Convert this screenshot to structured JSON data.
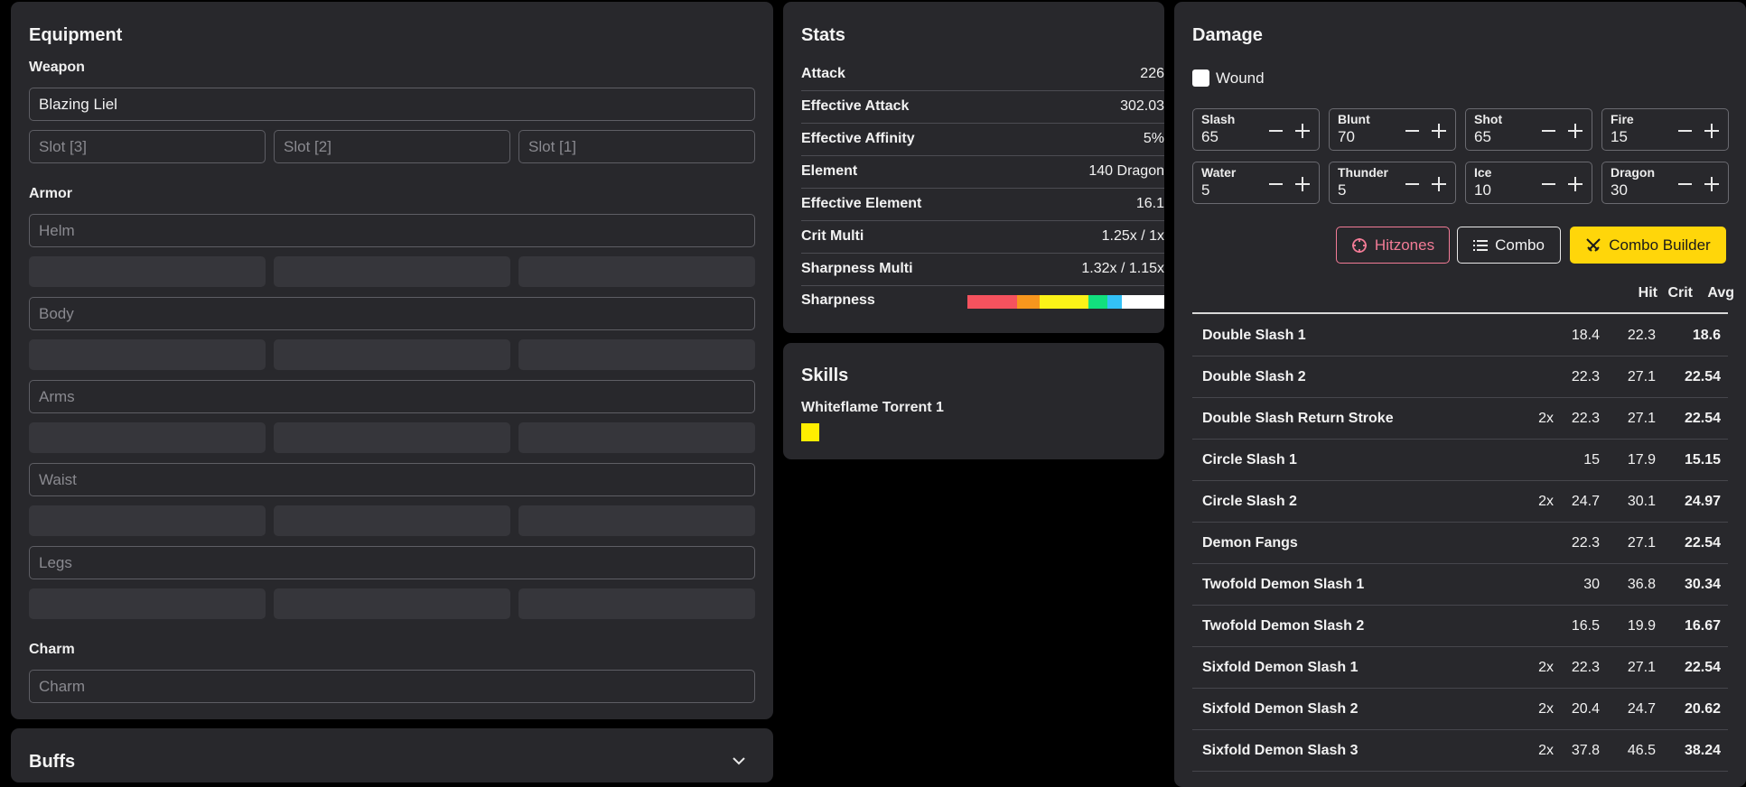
{
  "equipment": {
    "title": "Equipment",
    "weapon_label": "Weapon",
    "weapon_value": "Blazing Liel",
    "slots": [
      "Slot [3]",
      "Slot [2]",
      "Slot [1]"
    ],
    "armor_label": "Armor",
    "armor_pieces": [
      "Helm",
      "Body",
      "Arms",
      "Waist",
      "Legs"
    ],
    "charm_label": "Charm",
    "charm_placeholder": "Charm"
  },
  "buffs": {
    "title": "Buffs"
  },
  "stats": {
    "title": "Stats",
    "rows": [
      {
        "label": "Attack",
        "value": "226"
      },
      {
        "label": "Effective Attack",
        "value": "302.03"
      },
      {
        "label": "Effective Affinity",
        "value": "5%"
      },
      {
        "label": "Element",
        "value": "140 Dragon"
      },
      {
        "label": "Effective Element",
        "value": "16.1"
      },
      {
        "label": "Crit Multi",
        "value": "1.25x / 1x"
      },
      {
        "label": "Sharpness Multi",
        "value": "1.32x / 1.15x"
      }
    ],
    "sharpness_label": "Sharpness",
    "sharpness_segments": [
      {
        "color": "#f5525e",
        "fraction": 0.25
      },
      {
        "color": "#f7961d",
        "fraction": 0.115
      },
      {
        "color": "#fbf218",
        "fraction": 0.25
      },
      {
        "color": "#12e07e",
        "fraction": 0.095
      },
      {
        "color": "#33c1f7",
        "fraction": 0.075
      },
      {
        "color": "#ffffff",
        "fraction": 0.215
      }
    ]
  },
  "skills": {
    "title": "Skills",
    "items": [
      {
        "name": "Whiteflame Torrent 1",
        "level_color": "#ffee00"
      }
    ]
  },
  "damage": {
    "title": "Damage",
    "wound_label": "Wound",
    "wound_checked": false,
    "hitzones": [
      {
        "label": "Slash",
        "value": "65"
      },
      {
        "label": "Blunt",
        "value": "70"
      },
      {
        "label": "Shot",
        "value": "65"
      },
      {
        "label": "Fire",
        "value": "15"
      },
      {
        "label": "Water",
        "value": "5"
      },
      {
        "label": "Thunder",
        "value": "5"
      },
      {
        "label": "Ice",
        "value": "10"
      },
      {
        "label": "Dragon",
        "value": "30"
      }
    ],
    "buttons": {
      "hitzones": "Hitzones",
      "combo": "Combo",
      "combo_builder": "Combo Builder"
    },
    "columns": {
      "hit": "Hit",
      "crit": "Crit",
      "avg": "Avg"
    },
    "rows": [
      {
        "name": "Double Slash 1",
        "mult": "",
        "hit": "18.4",
        "crit": "22.3",
        "avg": "18.6"
      },
      {
        "name": "Double Slash 2",
        "mult": "",
        "hit": "22.3",
        "crit": "27.1",
        "avg": "22.54"
      },
      {
        "name": "Double Slash Return Stroke",
        "mult": "2x",
        "hit": "22.3",
        "crit": "27.1",
        "avg": "22.54"
      },
      {
        "name": "Circle Slash 1",
        "mult": "",
        "hit": "15",
        "crit": "17.9",
        "avg": "15.15"
      },
      {
        "name": "Circle Slash 2",
        "mult": "2x",
        "hit": "24.7",
        "crit": "30.1",
        "avg": "24.97"
      },
      {
        "name": "Demon Fangs",
        "mult": "",
        "hit": "22.3",
        "crit": "27.1",
        "avg": "22.54"
      },
      {
        "name": "Twofold Demon Slash 1",
        "mult": "",
        "hit": "30",
        "crit": "36.8",
        "avg": "30.34"
      },
      {
        "name": "Twofold Demon Slash 2",
        "mult": "",
        "hit": "16.5",
        "crit": "19.9",
        "avg": "16.67"
      },
      {
        "name": "Sixfold Demon Slash 1",
        "mult": "2x",
        "hit": "22.3",
        "crit": "27.1",
        "avg": "22.54"
      },
      {
        "name": "Sixfold Demon Slash 2",
        "mult": "2x",
        "hit": "20.4",
        "crit": "24.7",
        "avg": "20.62"
      },
      {
        "name": "Sixfold Demon Slash 3",
        "mult": "2x",
        "hit": "37.8",
        "crit": "46.5",
        "avg": "38.24"
      }
    ]
  },
  "colors": {
    "accent_yellow": "#ffd60a",
    "hitzones_pink": "#f27b96"
  }
}
